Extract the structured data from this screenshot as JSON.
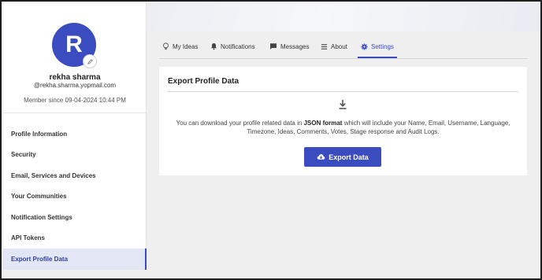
{
  "user": {
    "avatar_initial": "R",
    "name": "rekha sharma",
    "email": "@rekha.sharma.yopmail.com",
    "member_since": "Member since 09-04-2024 10:44 PM"
  },
  "sidebar": {
    "items": [
      {
        "label": "Profile Information",
        "active": false
      },
      {
        "label": "Security",
        "active": false
      },
      {
        "label": "Email, Services and Devices",
        "active": false
      },
      {
        "label": "Your Communities",
        "active": false
      },
      {
        "label": "Notification Settings",
        "active": false
      },
      {
        "label": "API Tokens",
        "active": false
      },
      {
        "label": "Export Profile Data",
        "active": true
      }
    ]
  },
  "tabs": [
    {
      "label": "My Ideas",
      "icon": "lightbulb-icon"
    },
    {
      "label": "Notifications",
      "icon": "bell-icon"
    },
    {
      "label": "Messages",
      "icon": "message-icon"
    },
    {
      "label": "About",
      "icon": "menu-lines-icon"
    },
    {
      "label": "Settings",
      "icon": "gear-icon",
      "active": true
    }
  ],
  "export": {
    "title": "Export Profile Data",
    "desc_pre": "You can download your profile related data in ",
    "desc_bold": "JSON format",
    "desc_post": " which will include your Name, Email, Username, Language, Timezone, Ideas, Comments, Votes, Stage response and Audit Logs.",
    "button_label": "Export Data",
    "button_icon": "cloud-download-icon",
    "top_icon": "download-icon"
  },
  "colors": {
    "accent": "#3b4cc0",
    "active_nav_bg": "#e3e7f5",
    "page_bg": "#efefef"
  }
}
